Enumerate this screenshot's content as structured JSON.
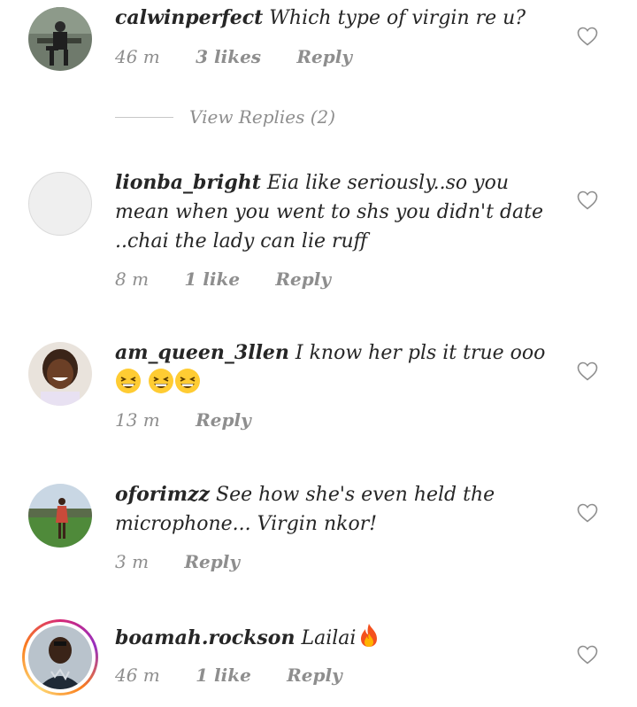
{
  "comments": [
    {
      "username": "calwinperfect",
      "text": "Which type of virgin re u?",
      "time": "46 m",
      "likes": "3 likes",
      "reply": "Reply",
      "view_replies": "View Replies (2)"
    },
    {
      "username": "lionba_bright",
      "text": "Eia like seriously..so you mean when you went to  shs you didn't date ..chai the lady can lie ruff",
      "time": "8 m",
      "likes": "1 like",
      "reply": "Reply"
    },
    {
      "username": "am_queen_3llen",
      "text": "I know her pls it true ooo",
      "emojis": [
        "grinning-squinting-face",
        "grinning-squinting-face",
        "grinning-squinting-face"
      ],
      "time": "13 m",
      "reply": "Reply"
    },
    {
      "username": "oforimzz",
      "text": "See how she's even held the microphone... Virgin nkor!",
      "time": "3 m",
      "reply": "Reply"
    },
    {
      "username": "boamah.rockson",
      "text": "Lailai",
      "emojis": [
        "fire"
      ],
      "time": "46 m",
      "likes": "1 like",
      "reply": "Reply"
    }
  ],
  "icons": {
    "like": "heart-outline-icon"
  },
  "colors": {
    "text": "#262626",
    "muted": "#8e8e8e",
    "story_ring": "#d62976"
  }
}
